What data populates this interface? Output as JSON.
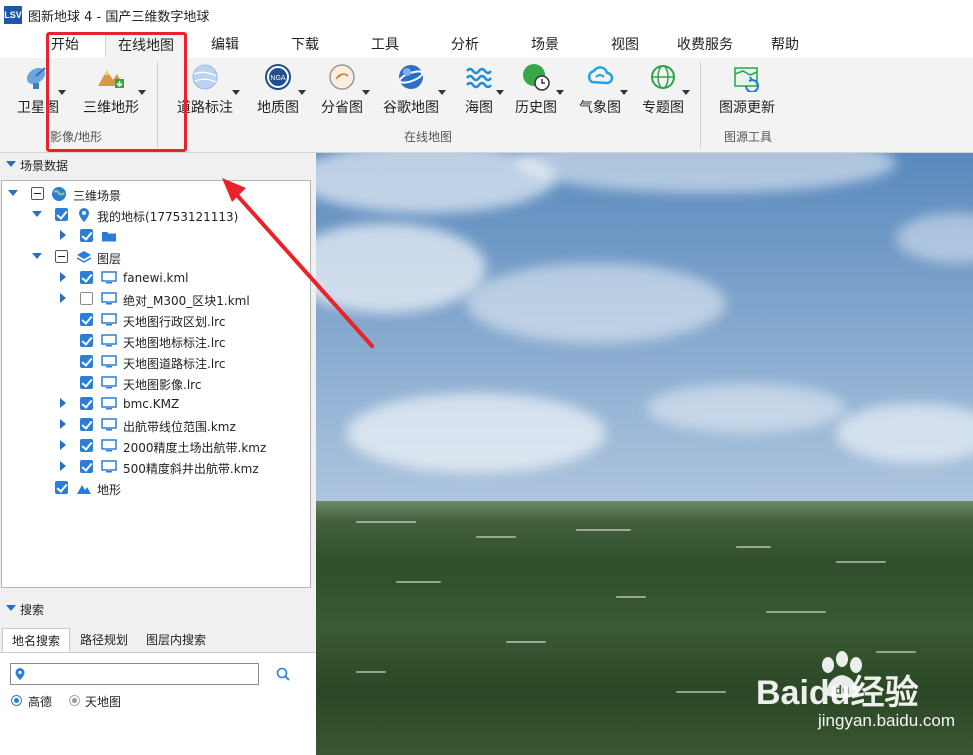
{
  "window": {
    "title": "图新地球 4 - 国产三维数字地球",
    "logo_text": "LSV"
  },
  "menu": {
    "tabs": [
      {
        "label": "开始"
      },
      {
        "label": "在线地图"
      },
      {
        "label": "编辑"
      },
      {
        "label": "下载"
      },
      {
        "label": "工具"
      },
      {
        "label": "分析"
      },
      {
        "label": "场景"
      },
      {
        "label": "视图"
      },
      {
        "label": "收费服务"
      },
      {
        "label": "帮助"
      }
    ],
    "active": "在线地图"
  },
  "ribbon": {
    "groups": [
      {
        "label": "影像/地形",
        "buttons": [
          {
            "label": "卫星图",
            "icon": "satellite-dish-icon"
          },
          {
            "label": "三维地形",
            "icon": "terrain-icon"
          }
        ]
      },
      {
        "label": "在线地图",
        "buttons": [
          {
            "label": "道路标注",
            "icon": "road-annotation-icon"
          },
          {
            "label": "地质图",
            "icon": "geology-map-icon",
            "icon_text": "NGA"
          },
          {
            "label": "分省图",
            "icon": "province-map-icon"
          },
          {
            "label": "谷歌地图",
            "icon": "google-earth-icon"
          },
          {
            "label": "海图",
            "icon": "sea-chart-icon"
          },
          {
            "label": "历史图",
            "icon": "history-map-icon"
          },
          {
            "label": "气象图",
            "icon": "weather-map-icon"
          },
          {
            "label": "专题图",
            "icon": "thematic-map-icon"
          }
        ]
      },
      {
        "label": "图源工具",
        "buttons": [
          {
            "label": "图源更新",
            "icon": "map-source-update-icon"
          }
        ]
      }
    ]
  },
  "scene_panel": {
    "header": "场景数据",
    "tree": {
      "root": "三维场景",
      "placemarks": "我的地标(17753121113)",
      "layers": "图层",
      "layer_items": [
        "fanewi.kml",
        "绝对_M300_区块1.kml",
        "天地图行政区划.lrc",
        "天地图地标标注.lrc",
        "天地图道路标注.lrc",
        "天地图影像.lrc",
        "bmc.KMZ",
        "出航带线位范围.kmz",
        "2000精度土场出航带.kmz",
        "500精度斜井出航带.kmz"
      ],
      "terrain": "地形"
    }
  },
  "search_panel": {
    "header": "搜索",
    "tabs": [
      "地名搜索",
      "路径规划",
      "图层内搜索"
    ],
    "input_value": "",
    "options": [
      "高德",
      "天地图"
    ],
    "selected_option": "高德"
  },
  "watermark": {
    "brand": "Baidu经验",
    "url": "jingyan.baidu.com"
  }
}
